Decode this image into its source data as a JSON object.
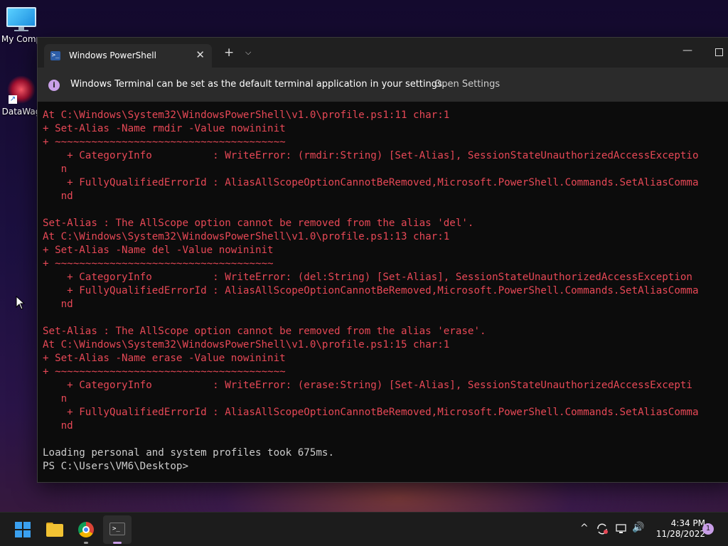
{
  "desktop": {
    "icons": [
      {
        "label": "My Comp",
        "icon": "computer-icon"
      },
      {
        "label": "DataWag",
        "icon": "datawag-icon"
      }
    ]
  },
  "window": {
    "tab_title": "Windows PowerShell",
    "tab_close": "✕",
    "new_tab": "+",
    "dropdown": "⌵",
    "minimize": "—"
  },
  "infobar": {
    "icon": "i",
    "message": "Windows Terminal can be set as the default terminal application in your settings.",
    "link": "Open Settings"
  },
  "console": {
    "lines": [
      {
        "text": "At C:\\Windows\\System32\\WindowsPowerShell\\v1.0\\profile.ps1:11 char:1",
        "style": "err"
      },
      {
        "text": "+ Set-Alias -Name rmdir -Value nowininit",
        "style": "err"
      },
      {
        "text": "+ ~~~~~~~~~~~~~~~~~~~~~~~~~~~~~~~~~~~~~~",
        "style": "err"
      },
      {
        "text": "    + CategoryInfo          : WriteError: (rmdir:String) [Set-Alias], SessionStateUnauthorizedAccessExceptio",
        "style": "err"
      },
      {
        "text": "   n",
        "style": "err"
      },
      {
        "text": "    + FullyQualifiedErrorId : AliasAllScopeOptionCannotBeRemoved,Microsoft.PowerShell.Commands.SetAliasComma",
        "style": "err"
      },
      {
        "text": "   nd",
        "style": "err"
      },
      {
        "text": "",
        "style": "err"
      },
      {
        "text": "Set-Alias : The AllScope option cannot be removed from the alias 'del'.",
        "style": "err"
      },
      {
        "text": "At C:\\Windows\\System32\\WindowsPowerShell\\v1.0\\profile.ps1:13 char:1",
        "style": "err"
      },
      {
        "text": "+ Set-Alias -Name del -Value nowininit",
        "style": "err"
      },
      {
        "text": "+ ~~~~~~~~~~~~~~~~~~~~~~~~~~~~~~~~~~~~",
        "style": "err"
      },
      {
        "text": "    + CategoryInfo          : WriteError: (del:String) [Set-Alias], SessionStateUnauthorizedAccessException",
        "style": "err"
      },
      {
        "text": "    + FullyQualifiedErrorId : AliasAllScopeOptionCannotBeRemoved,Microsoft.PowerShell.Commands.SetAliasComma",
        "style": "err"
      },
      {
        "text": "   nd",
        "style": "err"
      },
      {
        "text": "",
        "style": "err"
      },
      {
        "text": "Set-Alias : The AllScope option cannot be removed from the alias 'erase'.",
        "style": "err"
      },
      {
        "text": "At C:\\Windows\\System32\\WindowsPowerShell\\v1.0\\profile.ps1:15 char:1",
        "style": "err"
      },
      {
        "text": "+ Set-Alias -Name erase -Value nowininit",
        "style": "err"
      },
      {
        "text": "+ ~~~~~~~~~~~~~~~~~~~~~~~~~~~~~~~~~~~~~~",
        "style": "err"
      },
      {
        "text": "    + CategoryInfo          : WriteError: (erase:String) [Set-Alias], SessionStateUnauthorizedAccessExcepti",
        "style": "err"
      },
      {
        "text": "   n",
        "style": "err"
      },
      {
        "text": "    + FullyQualifiedErrorId : AliasAllScopeOptionCannotBeRemoved,Microsoft.PowerShell.Commands.SetAliasComma",
        "style": "err"
      },
      {
        "text": "   nd",
        "style": "err"
      },
      {
        "text": "",
        "style": "norm"
      },
      {
        "text": "Loading personal and system profiles took 675ms.",
        "style": "norm"
      },
      {
        "text": "PS C:\\Users\\VM6\\Desktop>",
        "style": "norm"
      }
    ]
  },
  "taskbar": {
    "clock_time": "4:34 PM",
    "clock_date": "11/28/2022",
    "notification_count": "1",
    "tray_chevron": "^",
    "volume": "🔊"
  },
  "colors": {
    "error_text": "#e74856",
    "normal_text": "#cccccc",
    "accent": "#c99ee8"
  }
}
